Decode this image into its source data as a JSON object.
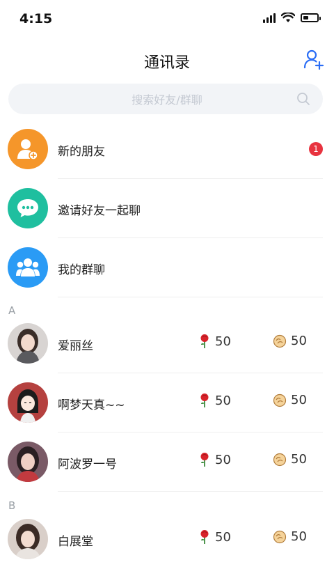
{
  "status": {
    "time": "4:15"
  },
  "header": {
    "title": "通讯录"
  },
  "search": {
    "placeholder": "搜索好友/群聊"
  },
  "functions": [
    {
      "label": "新的朋友",
      "badge": "1",
      "color": "#f5962a",
      "icon": "add-user-icon"
    },
    {
      "label": "邀请好友一起聊",
      "color": "#1fbf9f",
      "icon": "chat-bubble-icon"
    },
    {
      "label": "我的群聊",
      "color": "#2a9bf5",
      "icon": "group-icon"
    }
  ],
  "sections": [
    {
      "letter": "A",
      "contacts": [
        {
          "name": "爱丽丝",
          "roses": "50",
          "buns": "50"
        },
        {
          "name": "啊梦天真~~",
          "roses": "50",
          "buns": "50"
        },
        {
          "name": "阿波罗一号",
          "roses": "50",
          "buns": "50"
        }
      ]
    },
    {
      "letter": "B",
      "contacts": [
        {
          "name": "白展堂",
          "roses": "50",
          "buns": "50"
        }
      ]
    }
  ],
  "colors": {
    "accent": "#2a6df5",
    "badge": "#e8333f",
    "rose": "#d8232a",
    "bun": "#f0b45a"
  }
}
